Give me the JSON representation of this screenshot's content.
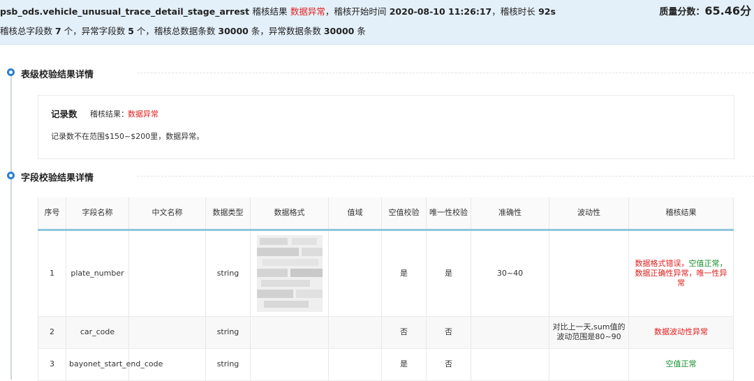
{
  "header": {
    "table_name": "psb_ods.vehicle_unusual_trace_detail_stage_arrest",
    "result_label": "稽核结果",
    "result_value": "数据异常",
    "start_time_label": "，稽核开始时间",
    "start_time": "2020-08-10 11:26:17",
    "duration_label": "，稽核时长",
    "duration": "92s",
    "score_label": "质量分数：",
    "score_value": "65.46分",
    "line2": {
      "p1": "稽核总字段数",
      "total_fields": "7",
      "p2": "个，异常字段数",
      "abnormal_fields": "5",
      "p3": "个，稽核总数据条数",
      "total_records": "30000",
      "p4": "条，异常数据条数",
      "abnormal_records": "30000",
      "p5": "条"
    }
  },
  "table_section": {
    "title": "表级校验结果详情",
    "record": {
      "title": "记录数",
      "result_label": "稽核结果：",
      "result_value": "数据异常",
      "description": "记录数不在范围$150~$200里，数据异常。"
    }
  },
  "field_section": {
    "title": "字段校验结果详情",
    "columns": [
      "序号",
      "字段名称",
      "中文名称",
      "数据类型",
      "数据格式",
      "值域",
      "空值校验",
      "唯一性校验",
      "准确性",
      "波动性",
      "稽核结果"
    ],
    "rows": [
      {
        "index": "1",
        "field_name": "plate_number",
        "cn_name": "",
        "data_type": "string",
        "format": "",
        "value_range": "",
        "null_check": "是",
        "unique_check": "是",
        "accuracy": "30~40",
        "volatility": "",
        "result_parts": [
          {
            "text": "数据格式错误，",
            "status": "bad"
          },
          {
            "text": "空值正常，",
            "status": "good"
          },
          {
            "text": "数据正确性异常，唯一性异常",
            "status": "bad"
          }
        ]
      },
      {
        "index": "2",
        "field_name": "car_code",
        "cn_name": "",
        "data_type": "string",
        "format": "",
        "value_range": "",
        "null_check": "否",
        "unique_check": "否",
        "accuracy": "",
        "volatility": "对比上一天,sum值的波动范围是80~90",
        "result_parts": [
          {
            "text": "数据波动性异常",
            "status": "bad"
          }
        ]
      },
      {
        "index": "3",
        "field_name": "bayonet_start_end_code",
        "cn_name": "",
        "data_type": "string",
        "format": "",
        "value_range": "",
        "null_check": "是",
        "unique_check": "否",
        "accuracy": "",
        "volatility": "",
        "result_parts": [
          {
            "text": "空值正常",
            "status": "good"
          }
        ]
      }
    ]
  },
  "colors": {
    "header_bg": "#e4f0f9",
    "accent": "#2b7fd0",
    "bad": "#e02020",
    "good": "#1a8f2e"
  }
}
